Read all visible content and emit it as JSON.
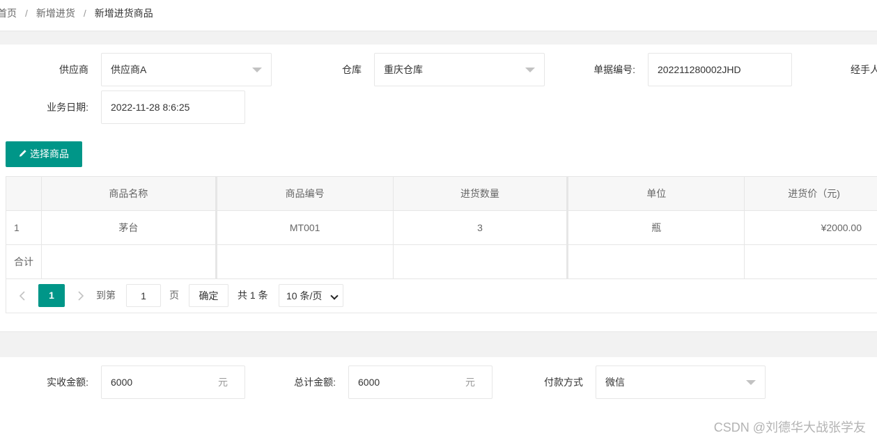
{
  "breadcrumb": {
    "home": "首页",
    "parent": "新增进货",
    "current": "新增进货商品",
    "sep": "/"
  },
  "form": {
    "supplier_label": "供应商",
    "supplier_value": "供应商A",
    "warehouse_label": "仓库",
    "warehouse_value": "重庆仓库",
    "docno_label": "单据编号:",
    "docno_value": "202211280002JHD",
    "handler_label": "经手人",
    "date_label": "业务日期:",
    "date_value": "2022-11-28 8:6:25"
  },
  "toolbar": {
    "select_goods_label": "选择商品",
    "select_goods_icon": "pencil-icon"
  },
  "table": {
    "headers": [
      "",
      "商品名称",
      "商品编号",
      "进货数量",
      "单位",
      "进货价（元)"
    ],
    "rows": [
      [
        "1",
        "茅台",
        "MT001",
        "3",
        "瓶",
        "¥2000.00"
      ]
    ],
    "total_label": "合计"
  },
  "pager": {
    "current_page": "1",
    "goto_label": "到第",
    "goto_value": "1",
    "page_unit": "页",
    "confirm_label": "确定",
    "total_text": "共 1 条",
    "page_size_value": "10 条/页"
  },
  "summary": {
    "received_label": "实收金额:",
    "received_value": "6000",
    "received_unit": "元",
    "total_label": "总计金额:",
    "total_value": "6000",
    "total_unit": "元",
    "payment_label": "付款方式",
    "payment_value": "微信"
  },
  "watermark": "CSDN @刘德华大战张学友",
  "colors": {
    "primary": "#009688",
    "border": "#e6e6e6",
    "band": "#f2f2f2"
  }
}
